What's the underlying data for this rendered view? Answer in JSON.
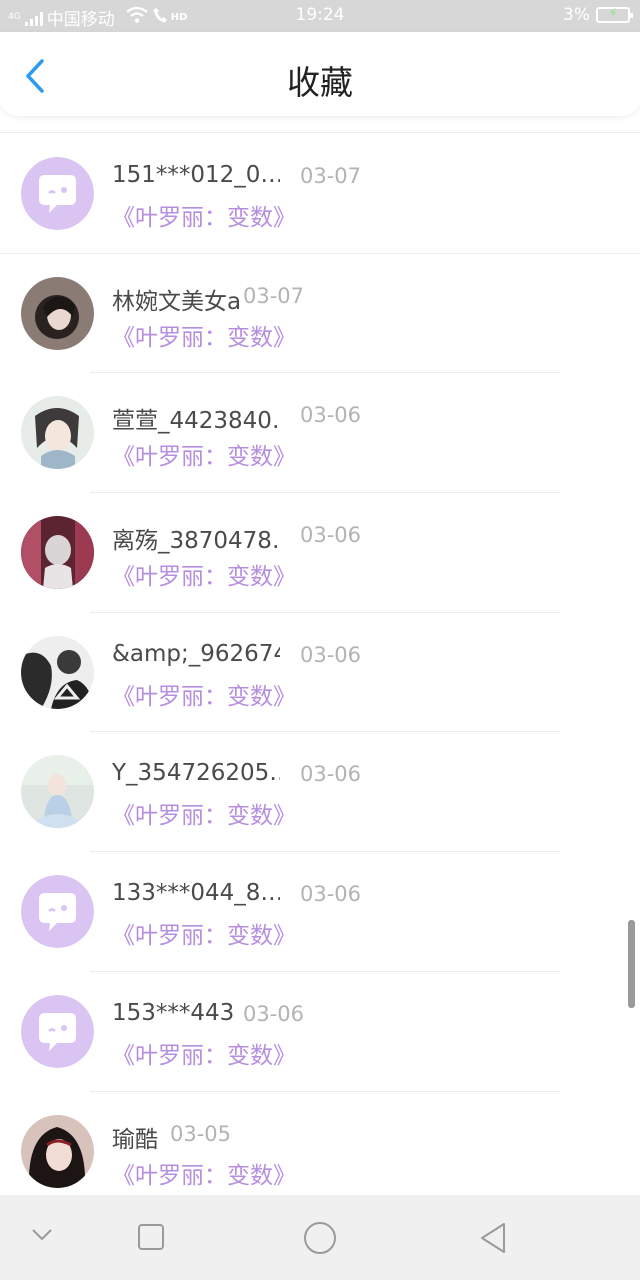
{
  "status": {
    "carrier": "中国移动",
    "network": "4G",
    "hd": "HD",
    "time": "19:24",
    "battery": "3%"
  },
  "header": {
    "title": "收藏"
  },
  "items": [
    {
      "name": "151***012_0…",
      "date": "03-07",
      "book": "《叶罗丽：变数》",
      "avatar": "default-avatar"
    },
    {
      "name": "林婉文美女a",
      "date": "03-07",
      "book": "《叶罗丽：变数》",
      "avatar": "user-photo"
    },
    {
      "name": "萱萱_4423840…",
      "date": "03-06",
      "book": "《叶罗丽：变数》",
      "avatar": "user-photo"
    },
    {
      "name": "离殇_3870478…",
      "date": "03-06",
      "book": "《叶罗丽：变数》",
      "avatar": "user-photo"
    },
    {
      "name": "&amp;_962674…",
      "date": "03-06",
      "book": "《叶罗丽：变数》",
      "avatar": "user-photo"
    },
    {
      "name": "Y_354726205…",
      "date": "03-06",
      "book": "《叶罗丽：变数》",
      "avatar": "user-photo"
    },
    {
      "name": "133***044_8…",
      "date": "03-06",
      "book": "《叶罗丽：变数》",
      "avatar": "default-avatar"
    },
    {
      "name": "153***443",
      "date": "03-06",
      "book": "《叶罗丽：变数》",
      "avatar": "default-avatar"
    },
    {
      "name": "瑜酷",
      "date": "03-05",
      "book": "《叶罗丽：变数》",
      "avatar": "user-photo"
    }
  ],
  "colors": {
    "accent": "#2d9cf0",
    "book_text": "#b58ede",
    "default_avatar_bg": "#d9c4f2"
  },
  "navbar": [
    "chevron-down-icon",
    "square-recents-icon",
    "circle-home-icon",
    "triangle-back-icon"
  ]
}
